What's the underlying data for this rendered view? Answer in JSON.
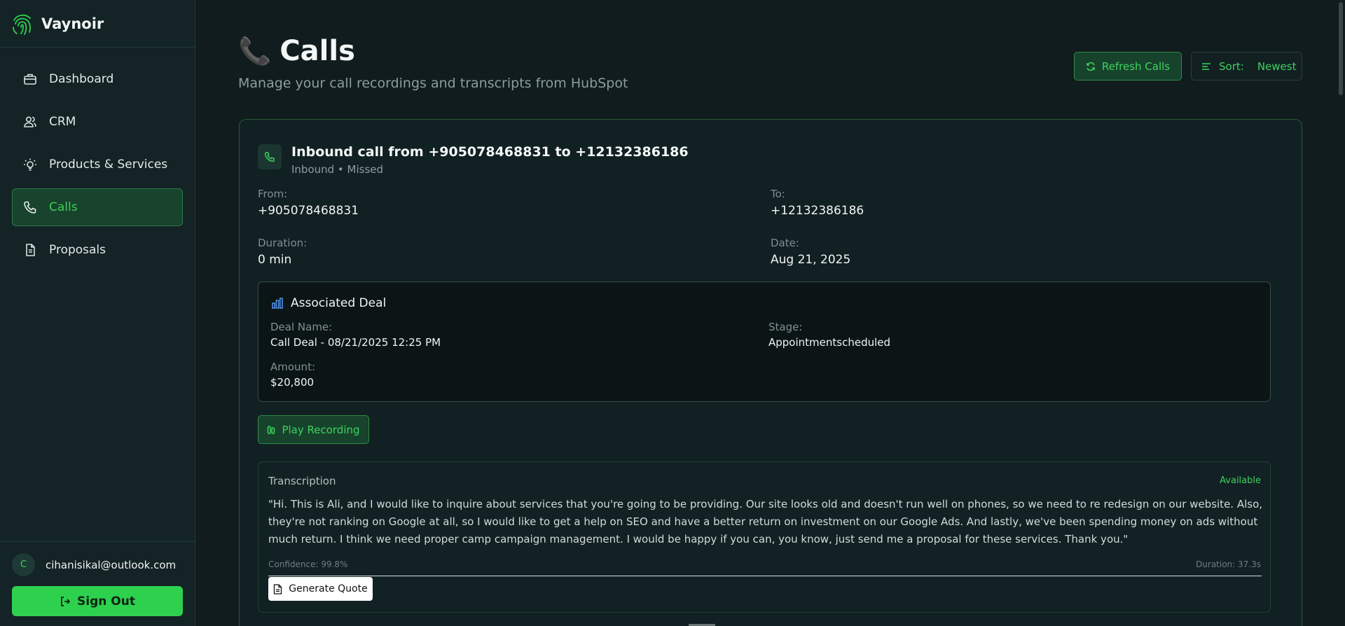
{
  "app": {
    "name": "Vaynoir"
  },
  "sidebar": {
    "items": [
      {
        "label": "Dashboard",
        "icon": "briefcase-icon",
        "active": false
      },
      {
        "label": "CRM",
        "icon": "users-icon",
        "active": false
      },
      {
        "label": "Products & Services",
        "icon": "lightbulb-icon",
        "active": false
      },
      {
        "label": "Calls",
        "icon": "phone-icon",
        "active": true
      },
      {
        "label": "Proposals",
        "icon": "document-icon",
        "active": false
      }
    ],
    "user": {
      "initial": "C",
      "email": "cihanisikal@outlook.com"
    },
    "signout_label": "Sign Out"
  },
  "header": {
    "title": "Calls",
    "title_emoji": "📞",
    "subtitle": "Manage your call recordings and transcripts from HubSpot",
    "refresh_label": "Refresh Calls",
    "sort_label": "Sort:",
    "sort_value": "Newest"
  },
  "call": {
    "title": "Inbound call from +905078468831 to +12132386186",
    "meta": "Inbound • Missed",
    "from_label": "From:",
    "from": "+905078468831",
    "to_label": "To:",
    "to": "+12132386186",
    "duration_label": "Duration:",
    "duration": "0 min",
    "date_label": "Date:",
    "date": "Aug 21, 2025",
    "deal": {
      "heading": "Associated Deal",
      "name_label": "Deal Name:",
      "name": "Call Deal - 08/21/2025 12:25 PM",
      "stage_label": "Stage:",
      "stage": "Appointmentscheduled",
      "amount_label": "Amount:",
      "amount": "$20,800"
    },
    "play_label": "Play Recording",
    "transcription": {
      "title": "Transcription",
      "status": "Available",
      "text": "\"Hi. This is Ali, and I would like to inquire about services that you're going to be providing. Our site looks old and doesn't run well on phones, so we need to re redesign on our website. Also, they're not ranking on Google at all, so I would like to get a help on SEO and have a better return on investment on our Google Ads. And lastly, we've been spending money on ads without much return. I think we need proper camp campaign management. I would be happy if you can, you know, just send me a proposal for these services. Thank you.\"",
      "confidence": "Confidence: 99.8%",
      "duration": "Duration: 37.3s",
      "quote_label": "Generate Quote"
    }
  },
  "colors": {
    "accent": "#2dd14e",
    "background": "#101c1e",
    "sidebar": "#142325"
  }
}
